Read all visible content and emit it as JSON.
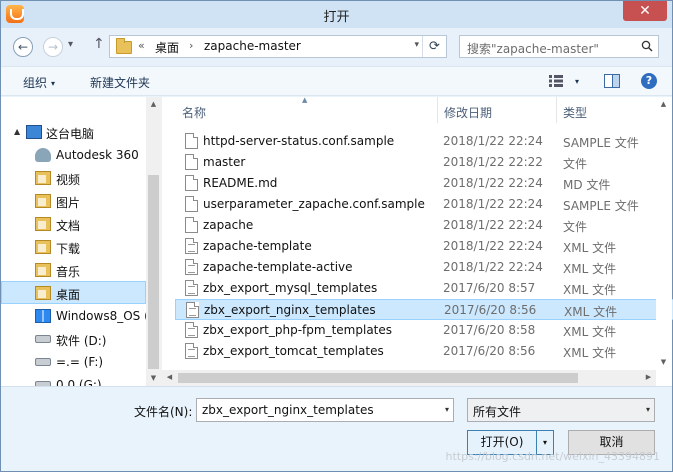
{
  "window": {
    "title": "打开",
    "close_glyph": "✕"
  },
  "nav": {
    "back_glyph": "←",
    "forward_glyph": "→",
    "up_glyph": "↑",
    "dropdown_glyph": "▾",
    "breadcrumb": {
      "overflow": "«",
      "items": [
        "桌面",
        "zapache-master"
      ],
      "separator": "›"
    },
    "refresh_glyph": "⟳",
    "search_placeholder": "搜索\"zapache-master\""
  },
  "toolbar": {
    "organize_label": "组织",
    "new_folder_label": "新建文件夹",
    "help_glyph": "?"
  },
  "sidebar": {
    "items": [
      {
        "label": "这台电脑",
        "icon": "pc-icon"
      },
      {
        "label": "Autodesk 360",
        "icon": "cloud-icon"
      },
      {
        "label": "视频",
        "icon": "video-library-icon"
      },
      {
        "label": "图片",
        "icon": "pictures-library-icon"
      },
      {
        "label": "文档",
        "icon": "documents-library-icon"
      },
      {
        "label": "下载",
        "icon": "downloads-library-icon"
      },
      {
        "label": "音乐",
        "icon": "music-library-icon"
      },
      {
        "label": "桌面",
        "icon": "desktop-folder-icon",
        "selected": true
      },
      {
        "label": "Windows8_OS (",
        "icon": "windows-drive-icon"
      },
      {
        "label": "软件 (D:)",
        "icon": "drive-icon"
      },
      {
        "label": "=.= (F:)",
        "icon": "drive-icon"
      },
      {
        "label": "0.0 (G:)",
        "icon": "drive-icon"
      }
    ]
  },
  "file_list": {
    "columns": {
      "name": "名称",
      "date": "修改日期",
      "type": "类型"
    },
    "rows": [
      {
        "name": "httpd-server-status.conf.sample",
        "date": "2018/1/22 22:24",
        "type": "SAMPLE 文件",
        "kind": "file"
      },
      {
        "name": "master",
        "date": "2018/1/22 22:22",
        "type": "文件",
        "kind": "file"
      },
      {
        "name": "README.md",
        "date": "2018/1/22 22:24",
        "type": "MD 文件",
        "kind": "file"
      },
      {
        "name": "userparameter_zapache.conf.sample",
        "date": "2018/1/22 22:24",
        "type": "SAMPLE 文件",
        "kind": "file"
      },
      {
        "name": "zapache",
        "date": "2018/1/22 22:24",
        "type": "文件",
        "kind": "file"
      },
      {
        "name": "zapache-template",
        "date": "2018/1/22 22:24",
        "type": "XML 文件",
        "kind": "xml"
      },
      {
        "name": "zapache-template-active",
        "date": "2018/1/22 22:24",
        "type": "XML 文件",
        "kind": "xml"
      },
      {
        "name": "zbx_export_mysql_templates",
        "date": "2017/6/20 8:57",
        "type": "XML 文件",
        "kind": "xml"
      },
      {
        "name": "zbx_export_nginx_templates",
        "date": "2017/6/20 8:56",
        "type": "XML 文件",
        "kind": "xml",
        "selected": true
      },
      {
        "name": "zbx_export_php-fpm_templates",
        "date": "2017/6/20 8:58",
        "type": "XML 文件",
        "kind": "xml"
      },
      {
        "name": "zbx_export_tomcat_templates",
        "date": "2017/6/20 8:56",
        "type": "XML 文件",
        "kind": "xml"
      }
    ]
  },
  "bottom": {
    "filename_label": "文件名(N):",
    "filename_value": "zbx_export_nginx_templates",
    "filetype_value": "所有文件",
    "open_label": "打开(O)",
    "cancel_label": "取消",
    "watermark": "https://blog.csdn.net/weixin_43394891"
  },
  "colors": {
    "selection": "#cce8ff",
    "selection_border": "#99d1ff",
    "title_bar": "#cfe3f5",
    "close": "#c75050"
  }
}
